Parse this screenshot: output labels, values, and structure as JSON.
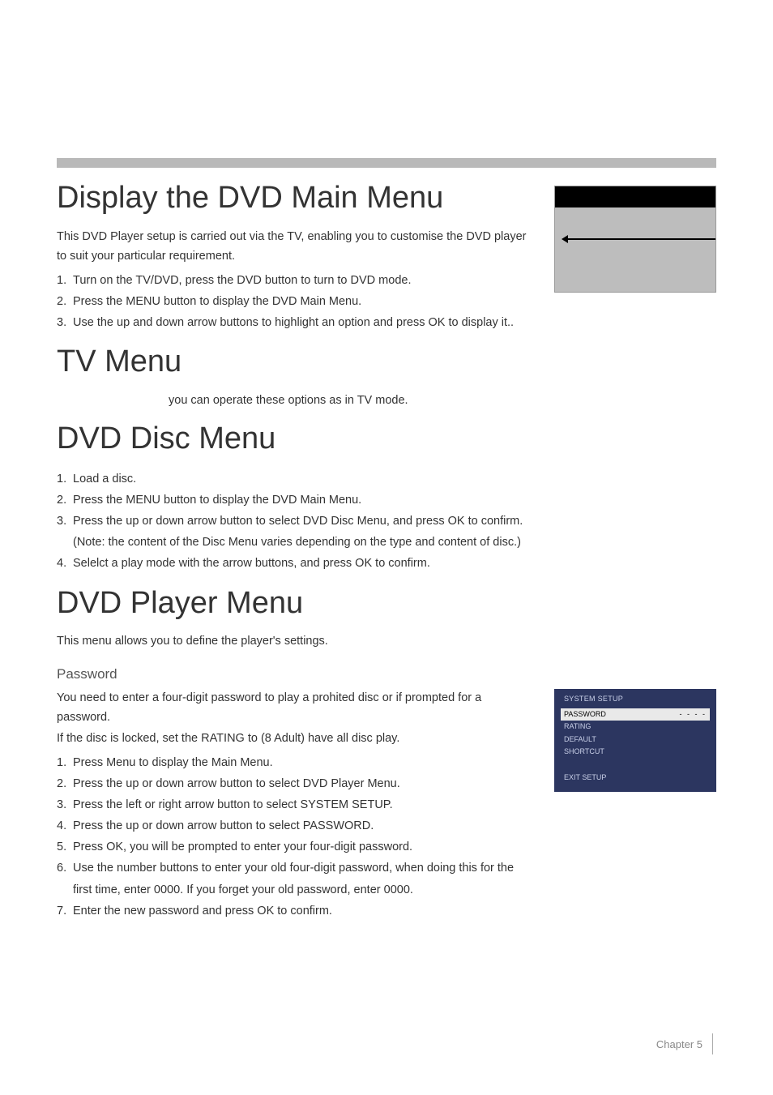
{
  "bar": {},
  "s1": {
    "title": "Display the DVD Main Menu",
    "intro": "This DVD Player setup is carried out via the TV, enabling you to customise the DVD player to suit your particular requirement.",
    "steps": [
      {
        "n": "1.",
        "t": "Turn on the TV/DVD, press the DVD button to turn to DVD mode."
      },
      {
        "n": "2.",
        "t": "Press the MENU button to display the DVD Main Menu."
      },
      {
        "n": "3.",
        "t": "Use the up and down arrow buttons to highlight an option and press OK to display it.."
      }
    ]
  },
  "s2": {
    "title": "TV Menu",
    "line": "you can operate these options as in TV mode."
  },
  "s3": {
    "title": "DVD Disc Menu",
    "steps": [
      {
        "n": "1.",
        "t": "Load a disc."
      },
      {
        "n": "2.",
        "t": "Press the MENU button to display the DVD Main Menu."
      },
      {
        "n": "3.",
        "t": "Press the up or down arrow button to select DVD Disc Menu, and press OK to confirm."
      },
      {
        "n": "4.",
        "t": "Selelct a play mode with the arrow buttons, and press OK to confirm."
      }
    ],
    "note": "(Note: the content of the Disc Menu varies depending on the type and content of disc.)"
  },
  "s4": {
    "title": "DVD Player Menu",
    "intro": "This menu allows you to define the player's settings.",
    "sub": "Password",
    "p1": "You need to enter a four-digit password to play a prohited disc or if prompted for a password.",
    "p2": "If the disc is locked, set the RATING to (8 Adult) have all disc play.",
    "steps": [
      {
        "n": "1.",
        "t": "Press Menu to display the Main Menu."
      },
      {
        "n": "2.",
        "t": "Press the up or down arrow button to select DVD Player Menu."
      },
      {
        "n": "3.",
        "t": "Press the left or right arrow button to select SYSTEM SETUP."
      },
      {
        "n": "4.",
        "t": "Press the up or down arrow button to select PASSWORD."
      },
      {
        "n": "5.",
        "t": "Press OK, you will be prompted to enter your four-digit password."
      },
      {
        "n": "6.",
        "t": "Use the number buttons to enter your old four-digit password, when doing this for the first time, enter 0000. If you forget your old password, enter 0000."
      },
      {
        "n": "7.",
        "t": "Enter the new password and press OK to confirm."
      }
    ]
  },
  "setup_fig": {
    "header": "SYSTEM SETUP",
    "rows": [
      {
        "label": "PASSWORD",
        "val": "- - - -",
        "sel": true
      },
      {
        "label": "RATING",
        "val": "",
        "sel": false
      },
      {
        "label": "DEFAULT",
        "val": "",
        "sel": false
      },
      {
        "label": "SHORTCUT",
        "val": "",
        "sel": false
      }
    ],
    "exit": "EXIT SETUP"
  },
  "footer": {
    "chapter": "Chapter 5"
  }
}
